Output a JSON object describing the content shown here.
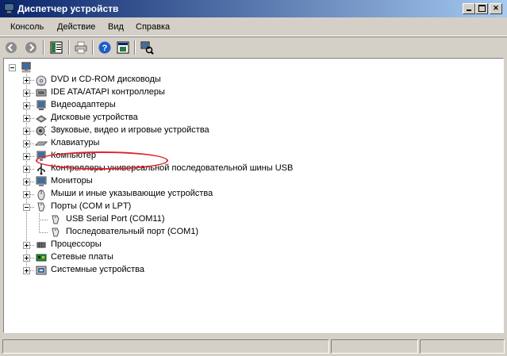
{
  "window": {
    "title": "Диспетчер устройств"
  },
  "menu": [
    "Консоль",
    "Действие",
    "Вид",
    "Справка"
  ],
  "toolbar": [
    "back-icon",
    "forward-icon",
    "properties-icon",
    "print-icon",
    "help-icon",
    "view-icon",
    "scan-hardware-icon"
  ],
  "tree": {
    "root": "computer-root",
    "categories": [
      {
        "label": "DVD и CD-ROM дисководы",
        "icon": "cdrom-icon",
        "expanded": false
      },
      {
        "label": "IDE ATA/ATAPI контроллеры",
        "icon": "ide-controller-icon",
        "expanded": false
      },
      {
        "label": "Видеоадаптеры",
        "icon": "display-adapter-icon",
        "expanded": false
      },
      {
        "label": "Дисковые устройства",
        "icon": "disk-drive-icon",
        "expanded": false
      },
      {
        "label": "Звуковые, видео и игровые устройства",
        "icon": "sound-icon",
        "expanded": false
      },
      {
        "label": "Клавиатуры",
        "icon": "keyboard-icon",
        "expanded": false
      },
      {
        "label": "Компьютер",
        "icon": "computer-icon",
        "expanded": false
      },
      {
        "label": "Контроллеры универсальной последовательной шины USB",
        "icon": "usb-icon",
        "expanded": false
      },
      {
        "label": "Мониторы",
        "icon": "monitor-icon",
        "expanded": false
      },
      {
        "label": "Мыши и иные указывающие устройства",
        "icon": "mouse-icon",
        "expanded": false
      },
      {
        "label": "Порты (COM и LPT)",
        "icon": "port-icon",
        "expanded": true,
        "children": [
          {
            "label": "USB Serial Port (COM11)",
            "icon": "port-icon"
          },
          {
            "label": "Последовательный порт (COM1)",
            "icon": "port-icon"
          }
        ]
      },
      {
        "label": "Процессоры",
        "icon": "processor-icon",
        "expanded": false
      },
      {
        "label": "Сетевые платы",
        "icon": "network-card-icon",
        "expanded": false
      },
      {
        "label": "Системные устройства",
        "icon": "system-device-icon",
        "expanded": false
      }
    ]
  },
  "colors": {
    "titlebar_start": "#0a246a",
    "titlebar_end": "#a6caf0",
    "highlight": "#e0202a",
    "face": "#d4d0c8"
  }
}
